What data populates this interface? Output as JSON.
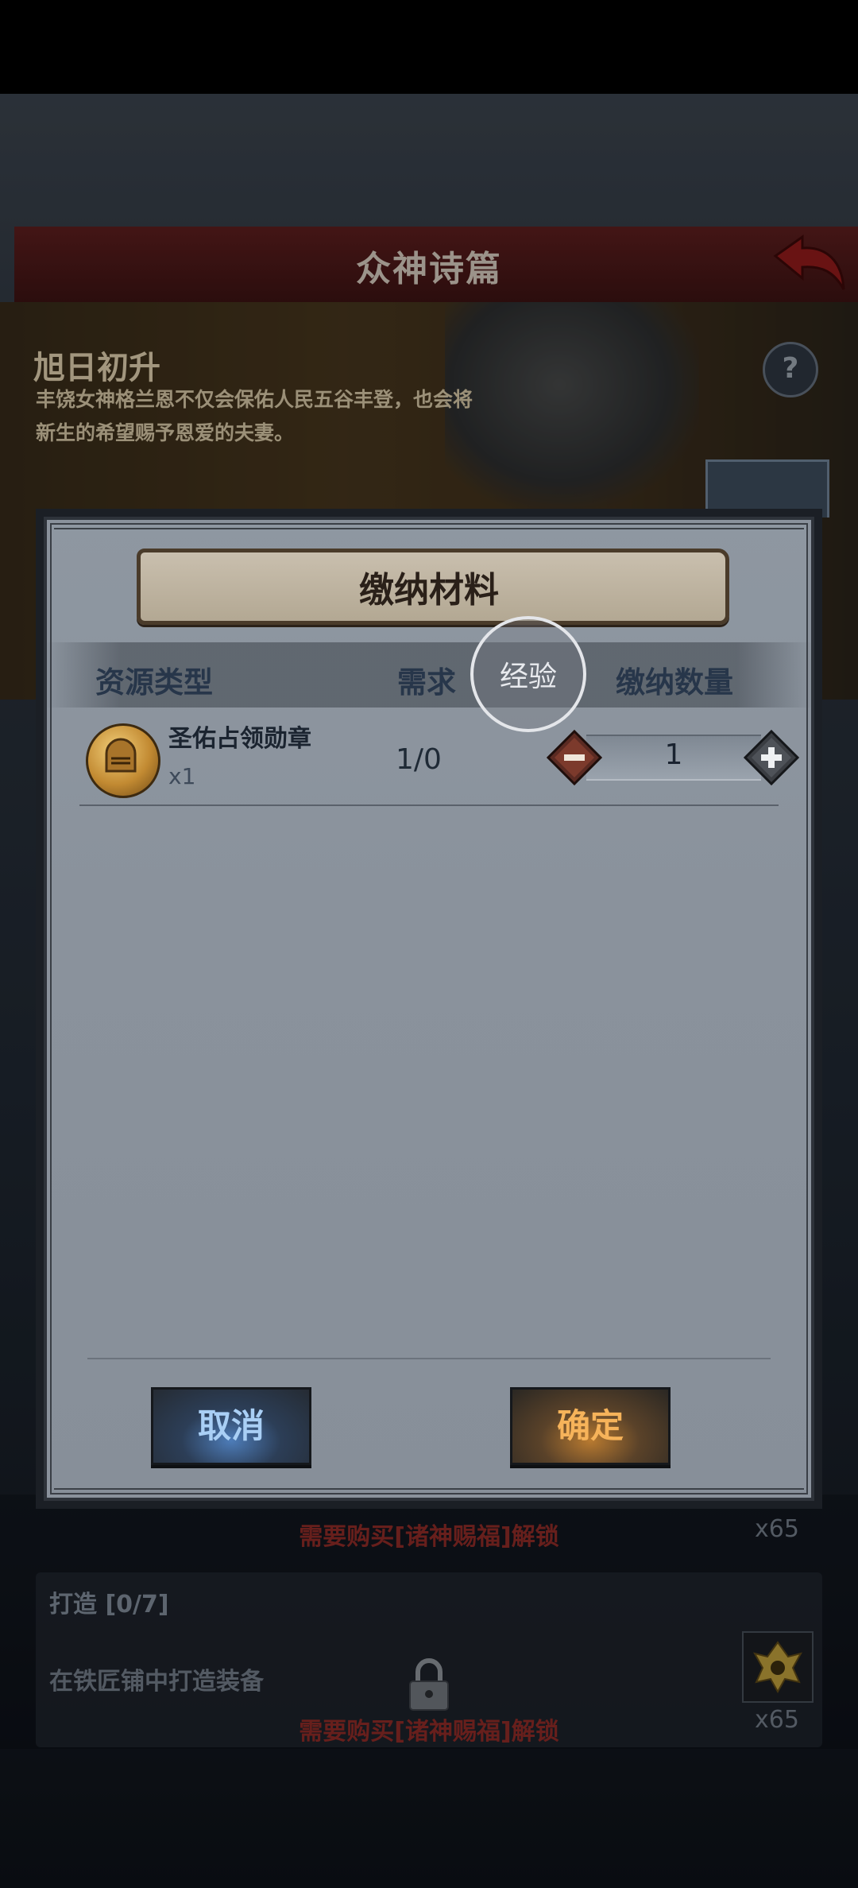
{
  "background_screen": {
    "title": "众神诗篇",
    "event": {
      "title": "旭日初升",
      "description": "丰饶女神格兰恩不仅会保佑人民五谷丰登，也会将新生的希望赐予恩爱的夫妻。"
    },
    "tasks": [
      {
        "locked_text": "需要购买[诸神赐福]解锁",
        "reward_count": "x65"
      },
      {
        "title": "打造 [0/7]",
        "description": "在铁匠铺中打造装备",
        "locked_text": "需要购买[诸神赐福]解锁",
        "reward_count": "x65"
      }
    ]
  },
  "modal": {
    "title": "缴纳材料",
    "columns": {
      "resource_type": "资源类型",
      "demand": "需求",
      "submit_qty": "缴纳数量"
    },
    "hint_circle": "经验",
    "rows": [
      {
        "name": "圣佑占领勋章",
        "qty": "x1",
        "demand": "1/0",
        "submit_value": "1"
      }
    ],
    "cancel_label": "取消",
    "confirm_label": "确定"
  },
  "colors": {
    "cancel_text": "#a9cff5",
    "confirm_text": "#f6b35a",
    "locked_text": "#8a2a26"
  },
  "icons": [
    "back-arrow-icon",
    "help-icon",
    "chest-icon",
    "lock-icon",
    "reward-emblem-icon",
    "medal-icon",
    "minus-icon",
    "plus-icon"
  ]
}
